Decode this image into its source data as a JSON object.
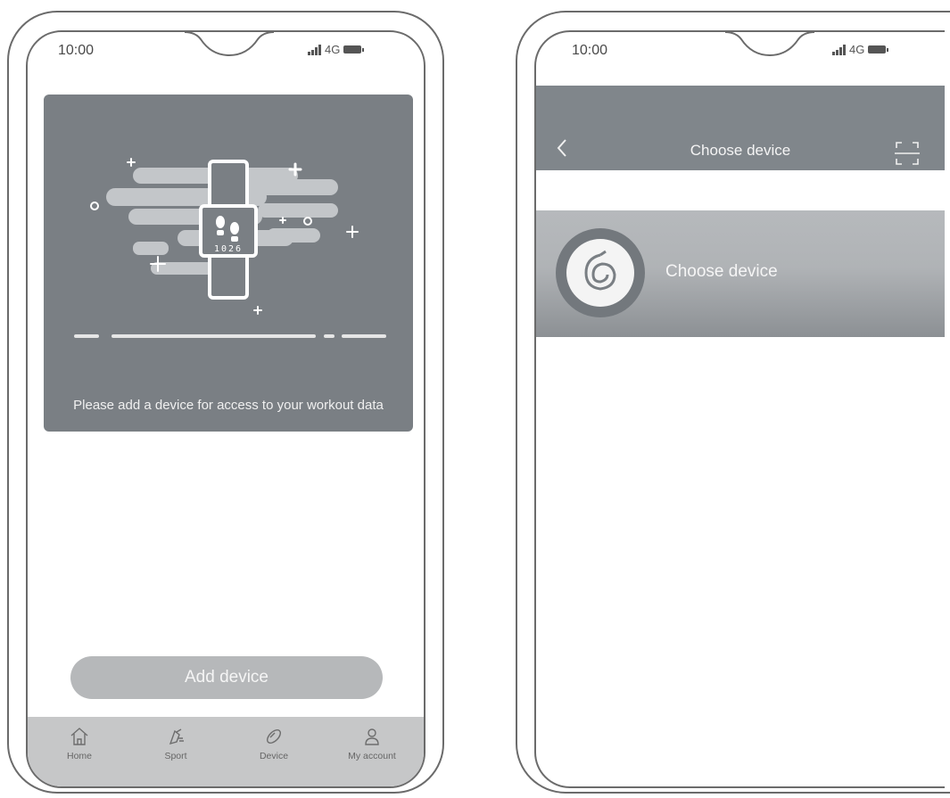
{
  "left_phone": {
    "status": {
      "time": "10:00",
      "network": "4G"
    },
    "hero": {
      "caption": "Please add a device for access to your workout data",
      "watch_display": "1026"
    },
    "add_button": {
      "label": "Add device"
    },
    "tabs": [
      {
        "label": "Home",
        "icon": "home-icon"
      },
      {
        "label": "Sport",
        "icon": "sport-icon"
      },
      {
        "label": "Device",
        "icon": "device-icon"
      },
      {
        "label": "My account",
        "icon": "account-icon"
      }
    ]
  },
  "right_phone": {
    "status": {
      "time": "10:00",
      "network": "4G"
    },
    "nav": {
      "title": "Choose device",
      "back_icon": "back-chevron-icon",
      "scan_icon": "scan-icon"
    },
    "device_item": {
      "label": "Choose device",
      "icon": "device-logo-icon"
    }
  },
  "colors": {
    "dark_gray": "#7a7f84",
    "nav_gray": "#80868b",
    "tabbar_gray": "#c6c7c8",
    "button_gray": "#b6b8ba"
  }
}
